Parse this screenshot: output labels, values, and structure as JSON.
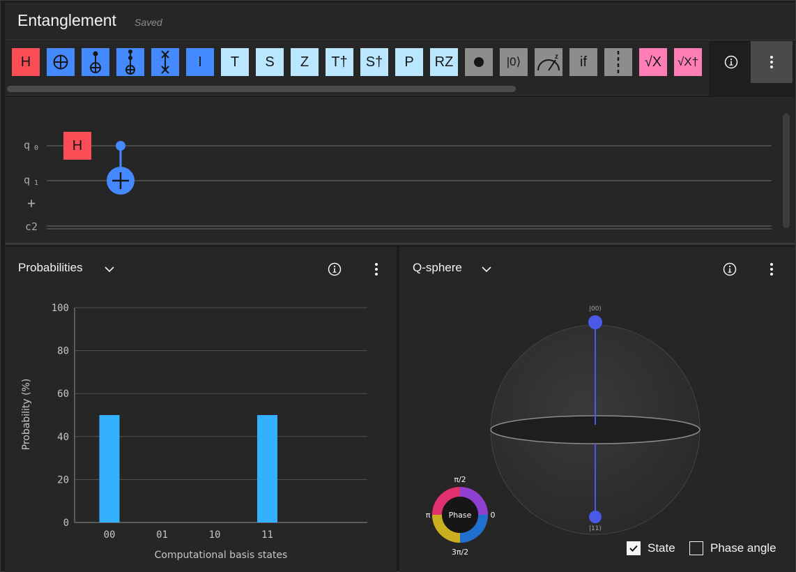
{
  "header": {
    "title": "Entanglement",
    "status": "Saved"
  },
  "toolbar": {
    "gates": [
      {
        "name": "h-gate",
        "label": "H",
        "style": "g-red"
      },
      {
        "name": "cnot-gate",
        "label": "",
        "style": "g-blue",
        "icon": "oplus-icon"
      },
      {
        "name": "toffoli-gate",
        "label": "",
        "style": "g-blue",
        "icon": "control-target-icon"
      },
      {
        "name": "multi-control-gate",
        "label": "",
        "style": "g-blue",
        "icon": "double-control-target-icon"
      },
      {
        "name": "swap-gate",
        "label": "",
        "style": "g-blue",
        "icon": "swap-icon"
      },
      {
        "name": "i-gate",
        "label": "I",
        "style": "g-blue"
      },
      {
        "name": "t-gate",
        "label": "T",
        "style": "g-light"
      },
      {
        "name": "s-gate",
        "label": "S",
        "style": "g-light"
      },
      {
        "name": "z-gate",
        "label": "Z",
        "style": "g-light"
      },
      {
        "name": "tdg-gate",
        "label": "T†",
        "style": "g-light"
      },
      {
        "name": "sdg-gate",
        "label": "S†",
        "style": "g-light"
      },
      {
        "name": "p-gate",
        "label": "P",
        "style": "g-light"
      },
      {
        "name": "rz-gate",
        "label": "RZ",
        "style": "g-light"
      },
      {
        "name": "barrier-dot-gate",
        "label": "",
        "style": "g-gray",
        "icon": "filled-dot-icon"
      },
      {
        "name": "reset-gate",
        "label": "|0⟩",
        "style": "g-gray"
      },
      {
        "name": "measure-gate",
        "label": "",
        "style": "g-gray",
        "icon": "meter-icon"
      },
      {
        "name": "if-gate",
        "label": "if",
        "style": "g-gray"
      },
      {
        "name": "barrier-gate",
        "label": "",
        "style": "g-gray",
        "icon": "dashed-line-icon"
      },
      {
        "name": "sx-gate",
        "label": "√X",
        "style": "g-pink"
      },
      {
        "name": "sxdg-gate",
        "label": "√X†",
        "style": "g-pink"
      }
    ]
  },
  "circuit": {
    "qubits": [
      {
        "label": "q",
        "index": "0"
      },
      {
        "label": "q",
        "index": "1"
      }
    ],
    "add_label": "+",
    "classical": {
      "label": "c2"
    },
    "placed_gate": "H"
  },
  "probabilities": {
    "title": "Probabilities",
    "chart_data": {
      "type": "bar",
      "categories": [
        "00",
        "01",
        "10",
        "11"
      ],
      "values": [
        50,
        0,
        0,
        50
      ],
      "xlabel": "Computational basis states",
      "ylabel": "Probability (%)",
      "ylim": [
        0,
        100
      ],
      "yticks": [
        0,
        20,
        40,
        60,
        80,
        100
      ],
      "bar_color": "#33b1ff",
      "grid": true
    }
  },
  "qsphere": {
    "title": "Q-sphere",
    "top_state": "|00⟩",
    "bottom_state": "|11⟩",
    "phase": {
      "center": "Phase",
      "top": "π/2",
      "left": "π",
      "right": "0",
      "bottom": "3π/2"
    },
    "state_label": "State",
    "state_checked": true,
    "phase_angle_label": "Phase angle",
    "phase_angle_checked": false,
    "node_color": "#4a5ae8"
  }
}
